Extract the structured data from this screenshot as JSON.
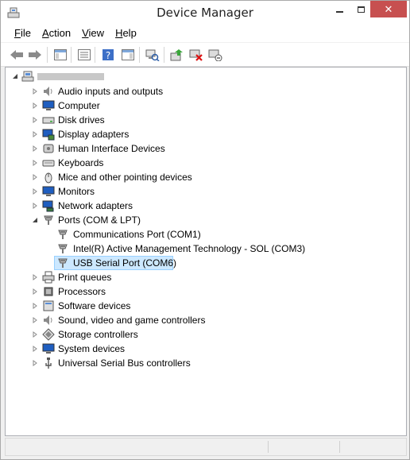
{
  "window": {
    "title": "Device Manager"
  },
  "menu": [
    {
      "mnemonic": "F",
      "rest": "ile"
    },
    {
      "mnemonic": "A",
      "rest": "ction"
    },
    {
      "mnemonic": "V",
      "rest": "iew"
    },
    {
      "mnemonic": "H",
      "rest": "elp"
    }
  ],
  "toolbar": {
    "buttons": [
      "back-arrow-icon",
      "forward-arrow-icon",
      "console-tree-icon",
      "properties-icon",
      "help-icon",
      "show-panel-icon",
      "scan-hardware-icon",
      "update-driver-icon",
      "uninstall-icon",
      "enable-device-icon"
    ]
  },
  "tree": {
    "root_label": "",
    "categories": [
      {
        "label": "Audio inputs and outputs",
        "icon": "speaker-icon"
      },
      {
        "label": "Computer",
        "icon": "computer-icon"
      },
      {
        "label": "Disk drives",
        "icon": "disk-drive-icon"
      },
      {
        "label": "Display adapters",
        "icon": "display-adapter-icon"
      },
      {
        "label": "Human Interface Devices",
        "icon": "hid-icon"
      },
      {
        "label": "Keyboards",
        "icon": "keyboard-icon"
      },
      {
        "label": "Mice and other pointing devices",
        "icon": "mouse-icon"
      },
      {
        "label": "Monitors",
        "icon": "monitor-icon"
      },
      {
        "label": "Network adapters",
        "icon": "network-adapter-icon"
      },
      {
        "label": "Ports (COM & LPT)",
        "icon": "port-icon",
        "expanded": true,
        "children": [
          {
            "label": "Communications Port (COM1)",
            "icon": "port-icon"
          },
          {
            "label": "Intel(R) Active Management Technology - SOL (COM3)",
            "icon": "port-icon"
          },
          {
            "label": "USB Serial Port (COM6)",
            "icon": "port-icon",
            "selected": true
          }
        ]
      },
      {
        "label": "Print queues",
        "icon": "printer-icon"
      },
      {
        "label": "Processors",
        "icon": "processor-icon"
      },
      {
        "label": "Software devices",
        "icon": "software-device-icon"
      },
      {
        "label": "Sound, video and game controllers",
        "icon": "sound-icon"
      },
      {
        "label": "Storage controllers",
        "icon": "storage-controller-icon"
      },
      {
        "label": "System devices",
        "icon": "system-device-icon"
      },
      {
        "label": "Universal Serial Bus controllers",
        "icon": "usb-icon"
      }
    ]
  }
}
